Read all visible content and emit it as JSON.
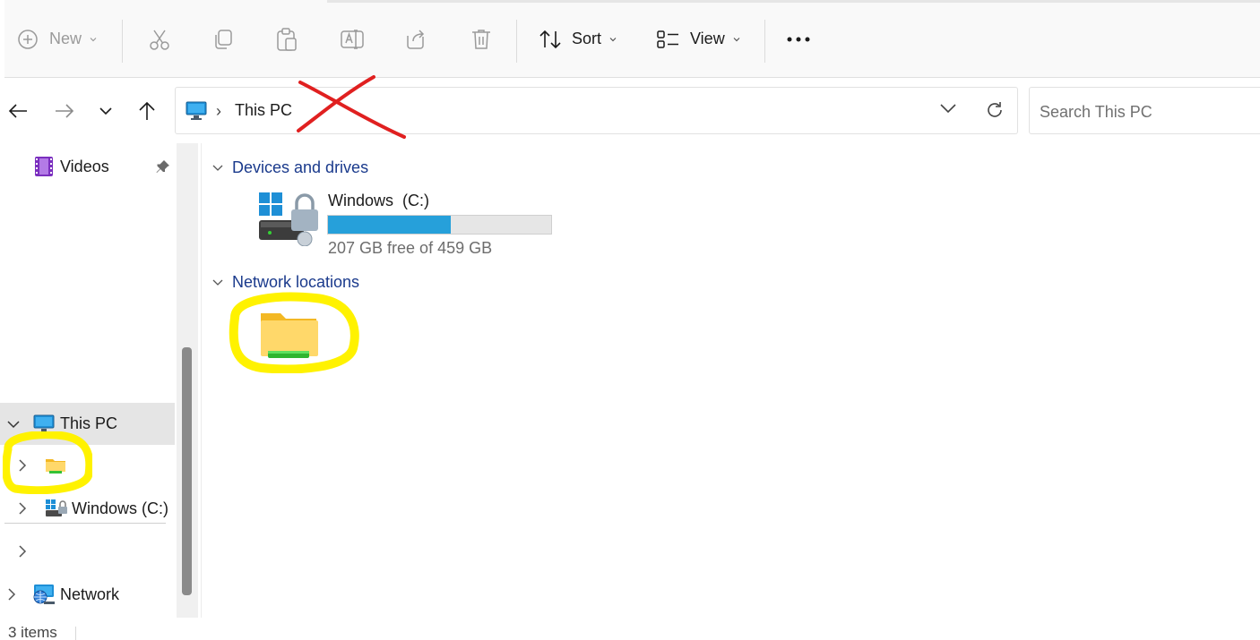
{
  "toolbar": {
    "new_label": "New",
    "sort_label": "Sort",
    "view_label": "View",
    "icons": [
      "plus-circle-icon",
      "cut-icon",
      "copy-icon",
      "paste-icon",
      "rename-icon",
      "share-icon",
      "delete-icon",
      "sort-icon",
      "view-icon",
      "more-icon"
    ]
  },
  "address": {
    "crumb": "This PC",
    "separator": "›",
    "search_placeholder": "Search This PC"
  },
  "sidebar": {
    "videos_label": "Videos",
    "this_pc_label": "This PC",
    "network_drive_label": "",
    "windows_label": "Windows  (C:)",
    "network_label": "Network"
  },
  "main": {
    "devices_heading": "Devices and drives",
    "network_heading": "Network locations",
    "drive": {
      "name": "Windows  (C:)",
      "free_text": "207 GB free of 459 GB",
      "used_fraction": 0.549
    },
    "network_location_label": ""
  },
  "status": {
    "items_text": "3 items"
  },
  "colors": {
    "accent": "#26a0da",
    "heading": "#1a3a8c",
    "annotation_red": "#e02020",
    "annotation_yellow": "#fff200"
  }
}
